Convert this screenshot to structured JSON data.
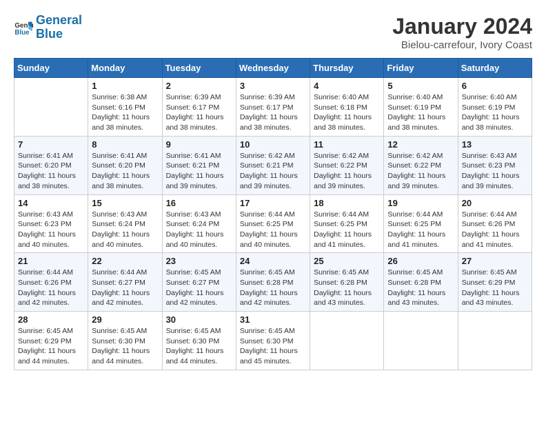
{
  "header": {
    "logo_line1": "General",
    "logo_line2": "Blue",
    "month_year": "January 2024",
    "location": "Bielou-carrefour, Ivory Coast"
  },
  "weekdays": [
    "Sunday",
    "Monday",
    "Tuesday",
    "Wednesday",
    "Thursday",
    "Friday",
    "Saturday"
  ],
  "weeks": [
    [
      {
        "day": "",
        "info": ""
      },
      {
        "day": "1",
        "info": "Sunrise: 6:38 AM\nSunset: 6:16 PM\nDaylight: 11 hours and 38 minutes."
      },
      {
        "day": "2",
        "info": "Sunrise: 6:39 AM\nSunset: 6:17 PM\nDaylight: 11 hours and 38 minutes."
      },
      {
        "day": "3",
        "info": "Sunrise: 6:39 AM\nSunset: 6:17 PM\nDaylight: 11 hours and 38 minutes."
      },
      {
        "day": "4",
        "info": "Sunrise: 6:40 AM\nSunset: 6:18 PM\nDaylight: 11 hours and 38 minutes."
      },
      {
        "day": "5",
        "info": "Sunrise: 6:40 AM\nSunset: 6:19 PM\nDaylight: 11 hours and 38 minutes."
      },
      {
        "day": "6",
        "info": "Sunrise: 6:40 AM\nSunset: 6:19 PM\nDaylight: 11 hours and 38 minutes."
      }
    ],
    [
      {
        "day": "7",
        "info": "Sunrise: 6:41 AM\nSunset: 6:20 PM\nDaylight: 11 hours and 38 minutes."
      },
      {
        "day": "8",
        "info": "Sunrise: 6:41 AM\nSunset: 6:20 PM\nDaylight: 11 hours and 38 minutes."
      },
      {
        "day": "9",
        "info": "Sunrise: 6:41 AM\nSunset: 6:21 PM\nDaylight: 11 hours and 39 minutes."
      },
      {
        "day": "10",
        "info": "Sunrise: 6:42 AM\nSunset: 6:21 PM\nDaylight: 11 hours and 39 minutes."
      },
      {
        "day": "11",
        "info": "Sunrise: 6:42 AM\nSunset: 6:22 PM\nDaylight: 11 hours and 39 minutes."
      },
      {
        "day": "12",
        "info": "Sunrise: 6:42 AM\nSunset: 6:22 PM\nDaylight: 11 hours and 39 minutes."
      },
      {
        "day": "13",
        "info": "Sunrise: 6:43 AM\nSunset: 6:23 PM\nDaylight: 11 hours and 39 minutes."
      }
    ],
    [
      {
        "day": "14",
        "info": "Sunrise: 6:43 AM\nSunset: 6:23 PM\nDaylight: 11 hours and 40 minutes."
      },
      {
        "day": "15",
        "info": "Sunrise: 6:43 AM\nSunset: 6:24 PM\nDaylight: 11 hours and 40 minutes."
      },
      {
        "day": "16",
        "info": "Sunrise: 6:43 AM\nSunset: 6:24 PM\nDaylight: 11 hours and 40 minutes."
      },
      {
        "day": "17",
        "info": "Sunrise: 6:44 AM\nSunset: 6:25 PM\nDaylight: 11 hours and 40 minutes."
      },
      {
        "day": "18",
        "info": "Sunrise: 6:44 AM\nSunset: 6:25 PM\nDaylight: 11 hours and 41 minutes."
      },
      {
        "day": "19",
        "info": "Sunrise: 6:44 AM\nSunset: 6:25 PM\nDaylight: 11 hours and 41 minutes."
      },
      {
        "day": "20",
        "info": "Sunrise: 6:44 AM\nSunset: 6:26 PM\nDaylight: 11 hours and 41 minutes."
      }
    ],
    [
      {
        "day": "21",
        "info": "Sunrise: 6:44 AM\nSunset: 6:26 PM\nDaylight: 11 hours and 42 minutes."
      },
      {
        "day": "22",
        "info": "Sunrise: 6:44 AM\nSunset: 6:27 PM\nDaylight: 11 hours and 42 minutes."
      },
      {
        "day": "23",
        "info": "Sunrise: 6:45 AM\nSunset: 6:27 PM\nDaylight: 11 hours and 42 minutes."
      },
      {
        "day": "24",
        "info": "Sunrise: 6:45 AM\nSunset: 6:28 PM\nDaylight: 11 hours and 42 minutes."
      },
      {
        "day": "25",
        "info": "Sunrise: 6:45 AM\nSunset: 6:28 PM\nDaylight: 11 hours and 43 minutes."
      },
      {
        "day": "26",
        "info": "Sunrise: 6:45 AM\nSunset: 6:28 PM\nDaylight: 11 hours and 43 minutes."
      },
      {
        "day": "27",
        "info": "Sunrise: 6:45 AM\nSunset: 6:29 PM\nDaylight: 11 hours and 43 minutes."
      }
    ],
    [
      {
        "day": "28",
        "info": "Sunrise: 6:45 AM\nSunset: 6:29 PM\nDaylight: 11 hours and 44 minutes."
      },
      {
        "day": "29",
        "info": "Sunrise: 6:45 AM\nSunset: 6:30 PM\nDaylight: 11 hours and 44 minutes."
      },
      {
        "day": "30",
        "info": "Sunrise: 6:45 AM\nSunset: 6:30 PM\nDaylight: 11 hours and 44 minutes."
      },
      {
        "day": "31",
        "info": "Sunrise: 6:45 AM\nSunset: 6:30 PM\nDaylight: 11 hours and 45 minutes."
      },
      {
        "day": "",
        "info": ""
      },
      {
        "day": "",
        "info": ""
      },
      {
        "day": "",
        "info": ""
      }
    ]
  ]
}
